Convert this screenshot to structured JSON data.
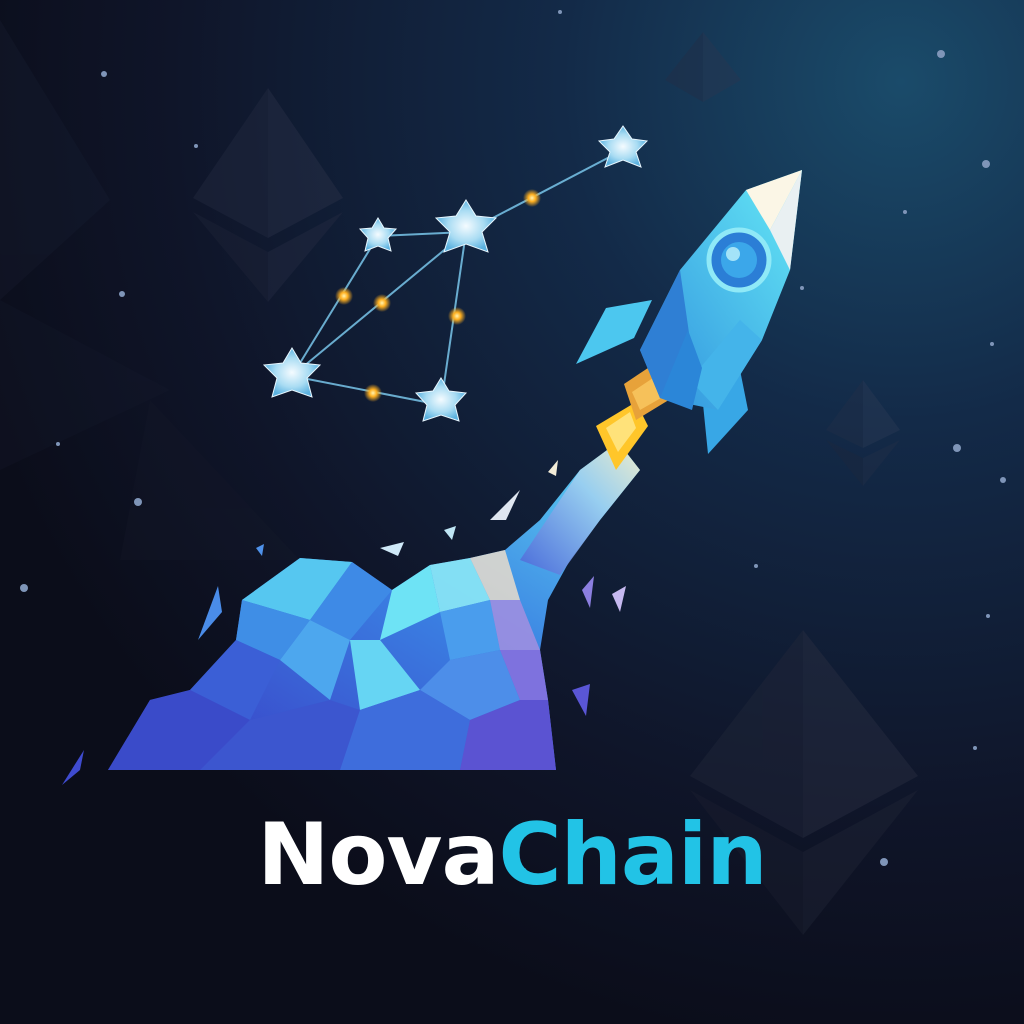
{
  "logo": {
    "text_part_1": "Nova",
    "text_part_2": "Chain"
  },
  "colors": {
    "background_top": "#153553",
    "background_bottom": "#0c0f1e",
    "wordmark_primary": "#ffffff",
    "wordmark_accent": "#22c3e6",
    "crystal_light": "#5ee6f5",
    "crystal_mid": "#3b8fe8",
    "crystal_deep": "#3a3fc4",
    "flame": "#ffc62a",
    "node_glow": "#ffb020"
  },
  "icons": [
    "rocket-icon",
    "constellation-icon",
    "crystal-cloud-icon",
    "ethereum-diamond-icon"
  ]
}
